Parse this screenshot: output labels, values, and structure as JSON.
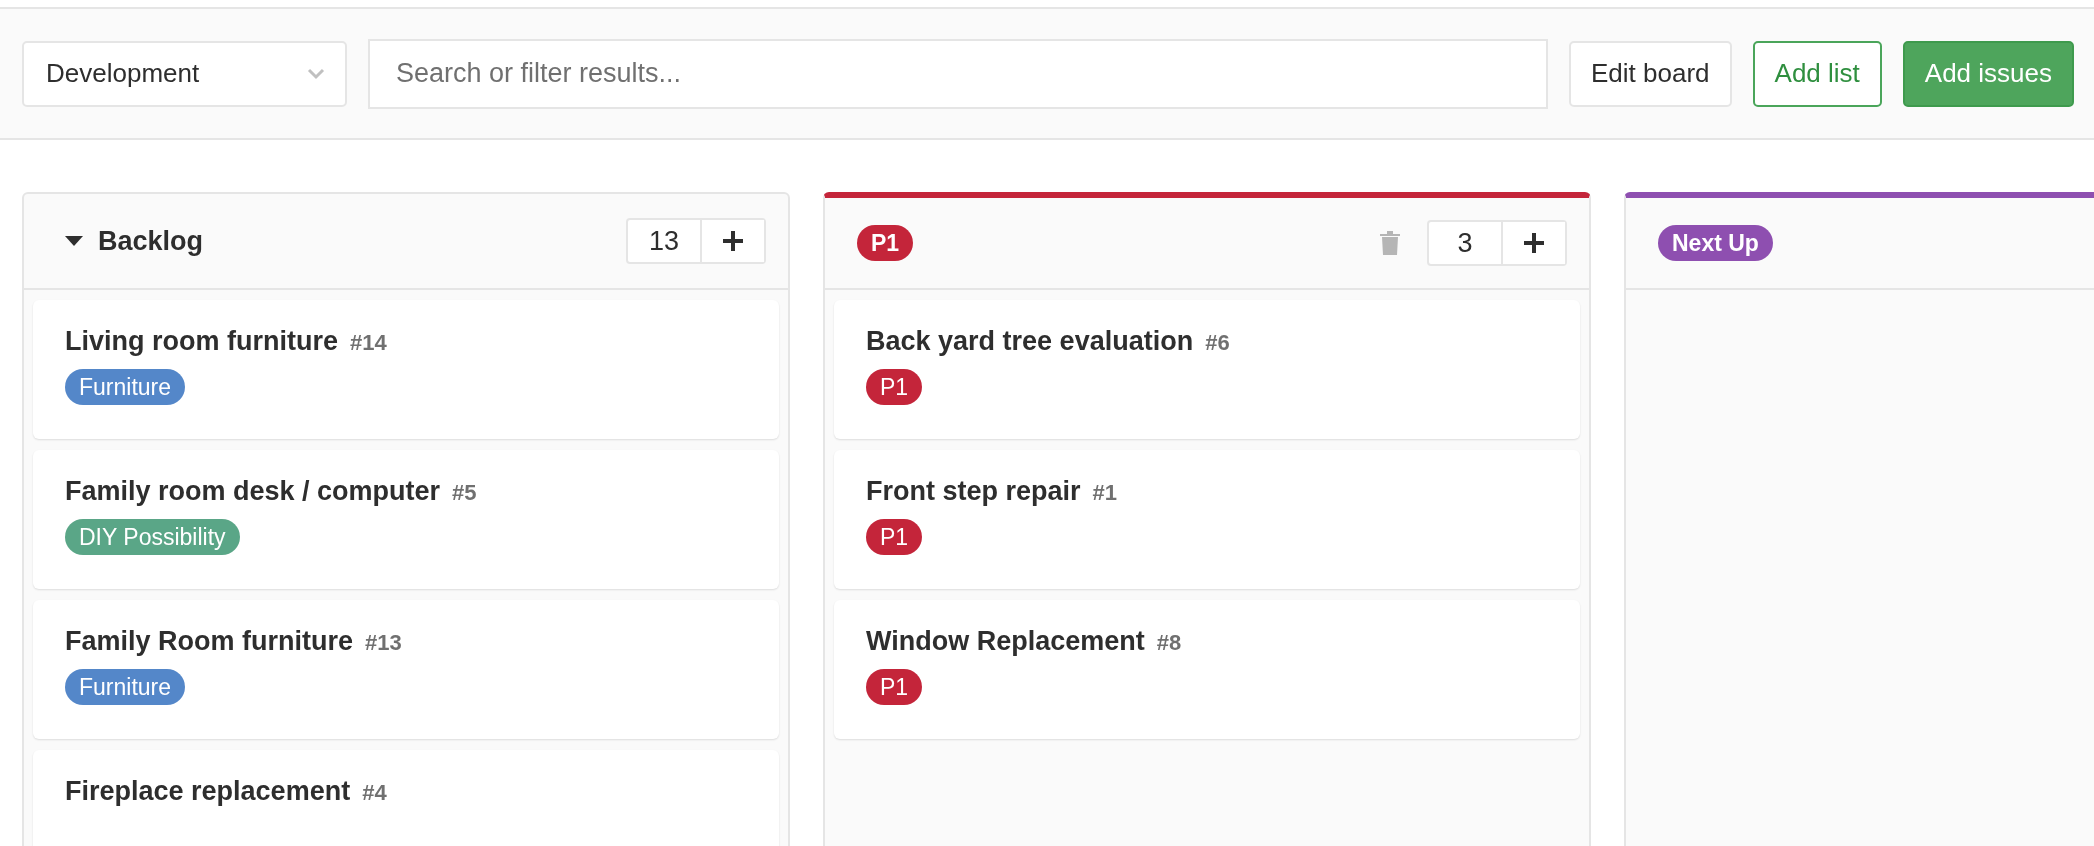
{
  "board_select": {
    "value": "Development"
  },
  "search": {
    "placeholder": "Search or filter results..."
  },
  "buttons": [
    {
      "label": "Edit board",
      "kind": "default"
    },
    {
      "label": "Add list",
      "kind": "outline"
    },
    {
      "label": "Add issues",
      "kind": "primary"
    }
  ],
  "lists": [
    {
      "kind": "title",
      "title": "Backlog",
      "expanded": true,
      "count": "13",
      "deletable": false,
      "cards": [
        {
          "title": "Living room furniture",
          "number": "#14",
          "labels": [
            {
              "text": "Furniture",
              "color": "#5487c9"
            }
          ]
        },
        {
          "title": "Family room desk / computer",
          "number": "#5",
          "labels": [
            {
              "text": "DIY Possibility",
              "color": "#5aa687"
            }
          ]
        },
        {
          "title": "Family Room furniture",
          "number": "#13",
          "labels": [
            {
              "text": "Furniture",
              "color": "#5487c9"
            }
          ]
        },
        {
          "title": "Fireplace replacement",
          "number": "#4"
        }
      ]
    },
    {
      "kind": "label",
      "label": "P1",
      "color": "#c4253a",
      "count": "3",
      "deletable": true,
      "cards": [
        {
          "title": "Back yard tree evaluation",
          "number": "#6",
          "labels": [
            {
              "text": "P1",
              "color": "#c4253a"
            }
          ]
        },
        {
          "title": "Front step repair",
          "number": "#1",
          "labels": [
            {
              "text": "P1",
              "color": "#c4253a"
            }
          ]
        },
        {
          "title": "Window Replacement",
          "number": "#8",
          "labels": [
            {
              "text": "P1",
              "color": "#c4253a"
            }
          ]
        }
      ]
    },
    {
      "kind": "label",
      "label": "Next Up",
      "color": "#8e4fb0",
      "deletable": false
    }
  ]
}
